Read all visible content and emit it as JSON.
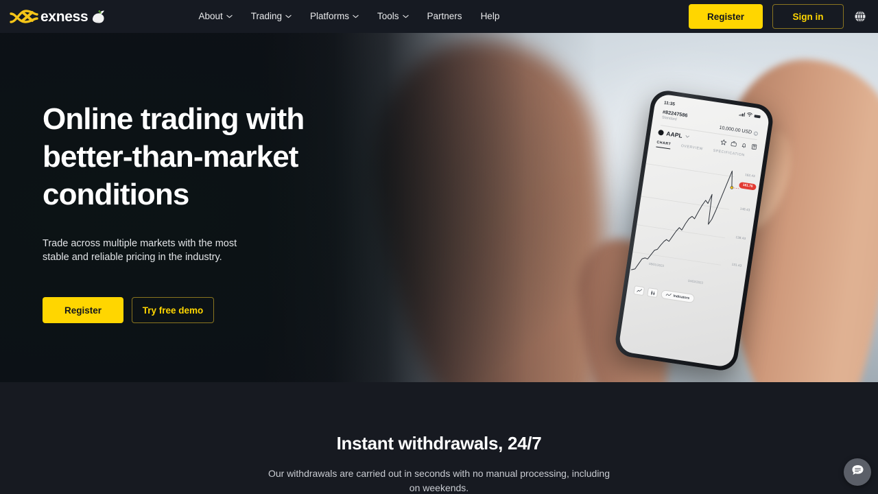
{
  "colors": {
    "brand_yellow": "#FFD600",
    "header_bg": "#161a22",
    "section_bg": "#171a21",
    "hero_dark": "#0d1016",
    "badge_red": "#e23b33"
  },
  "header": {
    "logo": {
      "text": "exness",
      "mark_icon": "exness-x-mark-icon",
      "dove_icon": "dove-icon"
    },
    "nav": [
      {
        "label": "About",
        "has_caret": true
      },
      {
        "label": "Trading",
        "has_caret": true
      },
      {
        "label": "Platforms",
        "has_caret": true
      },
      {
        "label": "Tools",
        "has_caret": true
      },
      {
        "label": "Partners",
        "has_caret": false
      },
      {
        "label": "Help",
        "has_caret": false
      }
    ],
    "register_label": "Register",
    "signin_label": "Sign in",
    "language_icon": "globe-icon"
  },
  "hero": {
    "title_lines": [
      "Online trading with",
      "better-than-market",
      "conditions"
    ],
    "title": "Online trading with better-than-market conditions",
    "subtitle": "Trade across multiple markets with the most stable and reliable pricing in the industry.",
    "register_label": "Register",
    "demo_label": "Try free demo"
  },
  "phone": {
    "status_time": "11:35",
    "account_number": "#82247586",
    "account_type": "Standard",
    "balance": "10,000.00 USD",
    "info_icon": "info-icon",
    "symbol": "AAPL",
    "symbol_caret_icon": "chevron-down-icon",
    "action_icons": [
      "star-icon",
      "briefcase-icon",
      "bell-icon",
      "calculator-icon"
    ],
    "tabs": [
      {
        "label": "CHART",
        "active": true
      },
      {
        "label": "OVERVIEW",
        "active": false
      },
      {
        "label": "SPECIFICATION",
        "active": false
      }
    ],
    "price_labels": [
      "162.43",
      "148.43",
      "138.43",
      "131.43"
    ],
    "current_price_badge": "161.76",
    "date_labels": [
      "08/01/2023",
      "04/02/2023"
    ],
    "toolbar": {
      "chart_type_icon": "line-chart-icon",
      "candles_icon": "candlestick-icon",
      "indicators_label": "Indicators",
      "indicators_icon": "indicators-icon"
    }
  },
  "chart_data": {
    "type": "line",
    "title": "AAPL",
    "ylabel": "",
    "xlabel": "",
    "ylim": [
      128,
      165
    ],
    "yticks": [
      131.43,
      138.43,
      148.43,
      162.43
    ],
    "x": [
      "08/01/2023",
      "04/02/2023"
    ],
    "values": [
      129.5,
      129.8,
      131.0,
      132.6,
      133.0,
      132.8,
      134.2,
      135.6,
      136.0,
      137.4,
      138.6,
      139.2,
      138.8,
      140.5,
      142.0,
      143.2,
      142.6,
      144.8,
      146.2,
      147.0,
      146.4,
      148.6,
      150.4,
      152.0,
      151.2,
      153.8,
      149.0,
      150.6,
      153.4,
      156.2,
      158.8,
      161.4,
      163.6,
      161.8
    ]
  },
  "section": {
    "title": "Instant withdrawals, 24/7",
    "subtitle": "Our withdrawals are carried out in seconds with no manual processing, including on weekends."
  },
  "chat": {
    "icon": "chat-bubble-icon",
    "label": "Chat"
  }
}
